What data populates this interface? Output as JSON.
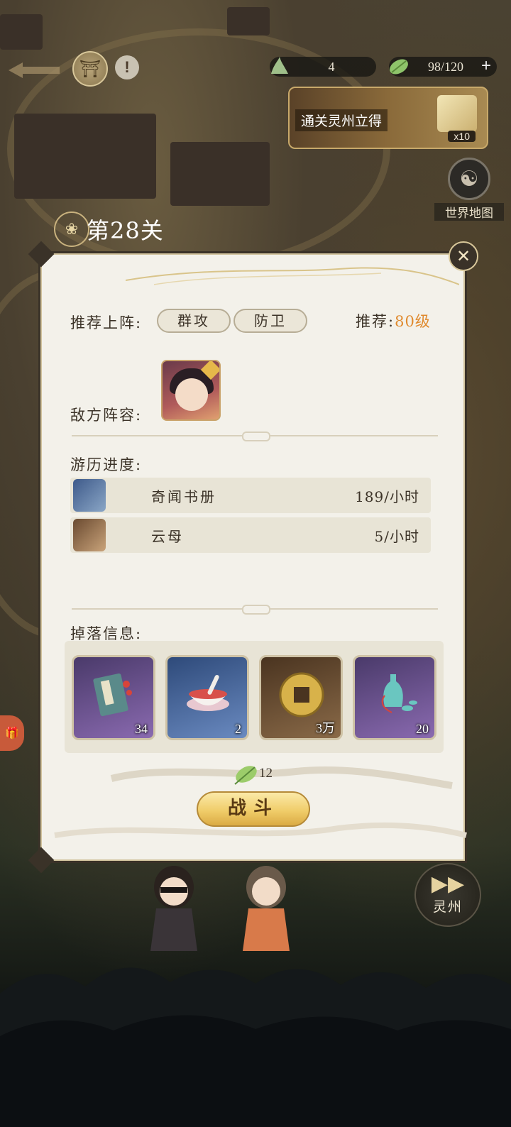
{
  "topbar": {
    "resource_a": "4",
    "resource_b": "98/120",
    "clear_reward_text": "通关灵州立得",
    "clear_reward_count": "x10",
    "world_map_label": "世界地图"
  },
  "level": {
    "title": "第28关"
  },
  "dialog": {
    "recommend_label": "推荐上阵:",
    "tags": [
      "群攻",
      "防卫"
    ],
    "recommend_prefix": "推荐:",
    "recommend_level": "80级",
    "enemy_label": "敌方阵容:",
    "progress_label": "游历进度:",
    "progress": [
      {
        "name": "奇闻书册",
        "rate": "189/小时",
        "icon": "book-icon"
      },
      {
        "name": "云母",
        "rate": "5/小时",
        "icon": "mica-icon"
      }
    ],
    "drops_label": "掉落信息:",
    "drops": [
      {
        "qty": "34",
        "icon": "book-item-icon",
        "color": "#6a4a8a"
      },
      {
        "qty": "2",
        "icon": "bowl-item-icon",
        "color": "#3e5a8a"
      },
      {
        "qty": "3万",
        "icon": "coin-item-icon",
        "color": "#6a4a30"
      },
      {
        "qty": "20",
        "icon": "vase-item-icon",
        "color": "#6a4a8a"
      }
    ],
    "cost": "12",
    "fight_label": "战斗"
  },
  "scene": {
    "next_area_label": "灵州"
  },
  "colors": {
    "accent_orange": "#e08a2e",
    "fight_button": "#f0cd6a",
    "dialog_bg": "#f3f1ea"
  }
}
